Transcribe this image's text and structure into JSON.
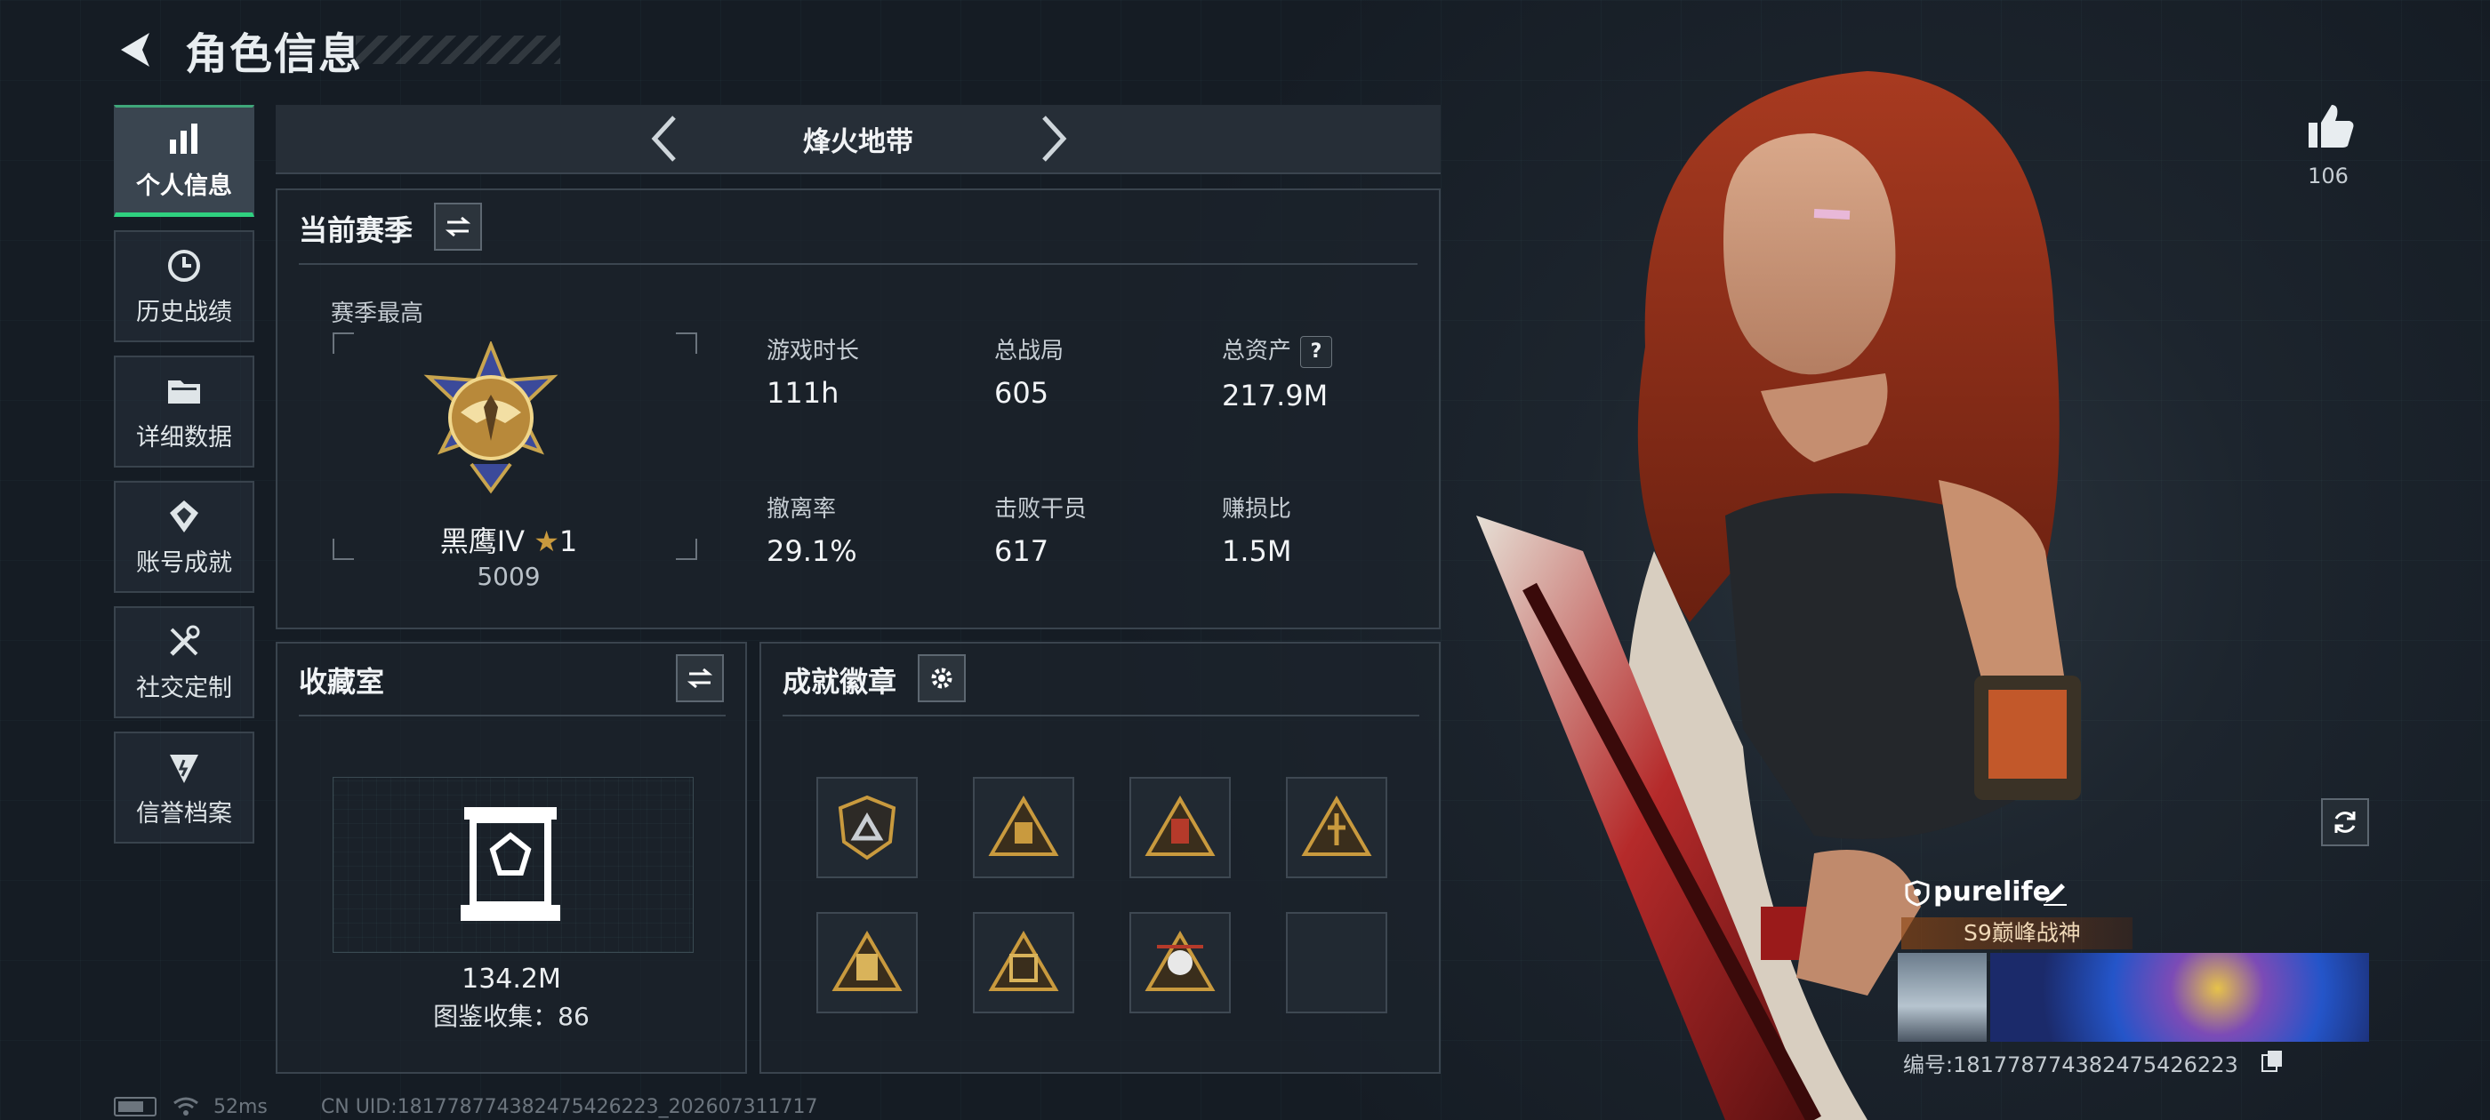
{
  "header": {
    "title": "角色信息"
  },
  "sidebar": {
    "items": [
      {
        "label": "个人信息",
        "icon": "bar-chart-icon",
        "active": true
      },
      {
        "label": "历史战绩",
        "icon": "history-clock-icon"
      },
      {
        "label": "详细数据",
        "icon": "folder-icon"
      },
      {
        "label": "账号成就",
        "icon": "achievement-badge-icon"
      },
      {
        "label": "社交定制",
        "icon": "tools-icon"
      },
      {
        "label": "信誉档案",
        "icon": "credit-shield-icon"
      }
    ]
  },
  "mode": {
    "title": "烽火地带"
  },
  "season": {
    "title": "当前赛季",
    "best_label": "赛季最高",
    "rank_name": "黑鹰IV",
    "rank_stars": "1",
    "rank_score": "5009",
    "stats": [
      {
        "label": "游戏时长",
        "value": "111h"
      },
      {
        "label": "总战局",
        "value": "605"
      },
      {
        "label": "总资产",
        "value": "217.9M",
        "help": "?"
      },
      {
        "label": "撤离率",
        "value": "29.1%"
      },
      {
        "label": "击败干员",
        "value": "617"
      },
      {
        "label": "赚损比",
        "value": "1.5M"
      }
    ]
  },
  "collection": {
    "title": "收藏室",
    "value": "134.2M",
    "count_text": "图鉴收集：86"
  },
  "achievements": {
    "title": "成就徽章",
    "slots": 8
  },
  "likes": {
    "count": "106"
  },
  "player": {
    "name": "purelife",
    "title": "S9巅峰战神",
    "id_text": "编号:18177877438247542622​3"
  },
  "footer": {
    "ping": "52ms",
    "uid": "CN UID:181778774382475426223_202607311717"
  },
  "colors": {
    "accent_green": "#2fd07f",
    "gold": "#c99a3e",
    "bg": "#151c24"
  }
}
